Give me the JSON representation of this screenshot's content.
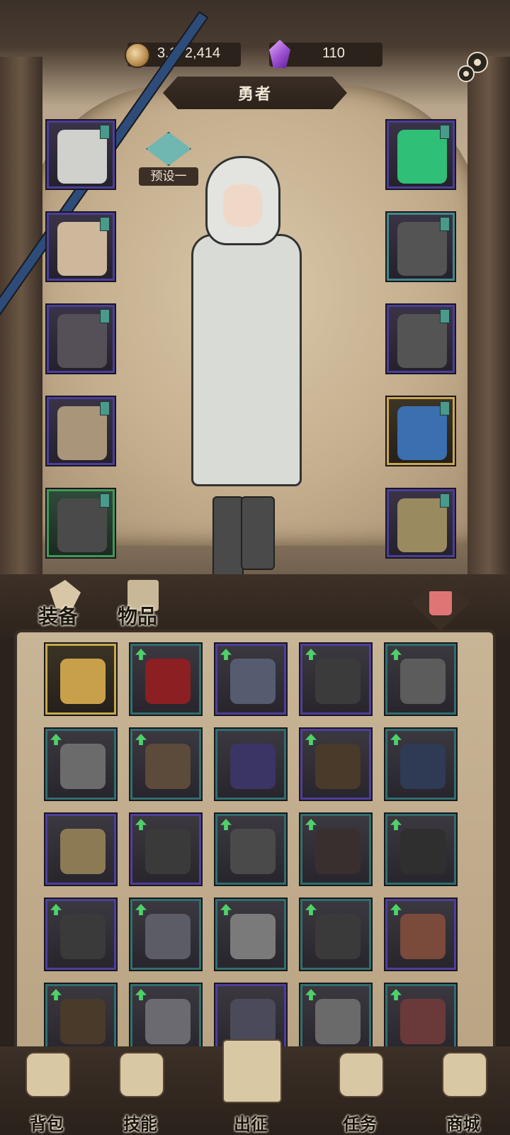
{
  "currency": {
    "gold": "3,172,414",
    "gems": "110"
  },
  "header": {
    "title": "勇者",
    "preset_label": "预设一"
  },
  "tabs": {
    "equip": "装备",
    "items": "物品"
  },
  "equipment_left": [
    {
      "name": "hood",
      "frame": "purple"
    },
    {
      "name": "tunic",
      "frame": "purple"
    },
    {
      "name": "gauntlet",
      "frame": "purple"
    },
    {
      "name": "pants",
      "frame": "purple"
    },
    {
      "name": "boots",
      "frame": "green"
    }
  ],
  "equipment_right": [
    {
      "name": "amulet",
      "frame": "purple"
    },
    {
      "name": "ring",
      "frame": "teal"
    },
    {
      "name": "ring",
      "frame": "purple"
    },
    {
      "name": "staff",
      "frame": "gold"
    },
    {
      "name": "tome",
      "frame": "purple"
    }
  ],
  "inventory": [
    {
      "frame": "gold",
      "upgrade": false
    },
    {
      "frame": "teal",
      "upgrade": true
    },
    {
      "frame": "purple",
      "upgrade": true
    },
    {
      "frame": "purple",
      "upgrade": true
    },
    {
      "frame": "teal",
      "upgrade": true
    },
    {
      "frame": "teal",
      "upgrade": true
    },
    {
      "frame": "teal",
      "upgrade": true
    },
    {
      "frame": "teal",
      "upgrade": false
    },
    {
      "frame": "purple",
      "upgrade": true
    },
    {
      "frame": "teal",
      "upgrade": true
    },
    {
      "frame": "purple",
      "upgrade": false
    },
    {
      "frame": "purple",
      "upgrade": true
    },
    {
      "frame": "teal",
      "upgrade": true
    },
    {
      "frame": "teal",
      "upgrade": true
    },
    {
      "frame": "teal",
      "upgrade": true
    },
    {
      "frame": "purple",
      "upgrade": true
    },
    {
      "frame": "teal",
      "upgrade": true
    },
    {
      "frame": "teal",
      "upgrade": true
    },
    {
      "frame": "teal",
      "upgrade": true
    },
    {
      "frame": "purple",
      "upgrade": true
    },
    {
      "frame": "teal",
      "upgrade": true
    },
    {
      "frame": "teal",
      "upgrade": true
    },
    {
      "frame": "purple",
      "upgrade": false
    },
    {
      "frame": "teal",
      "upgrade": true
    },
    {
      "frame": "teal",
      "upgrade": true
    }
  ],
  "nav": [
    {
      "label": "背包"
    },
    {
      "label": "技能"
    },
    {
      "label": "出征"
    },
    {
      "label": "任务"
    },
    {
      "label": "商城"
    }
  ]
}
